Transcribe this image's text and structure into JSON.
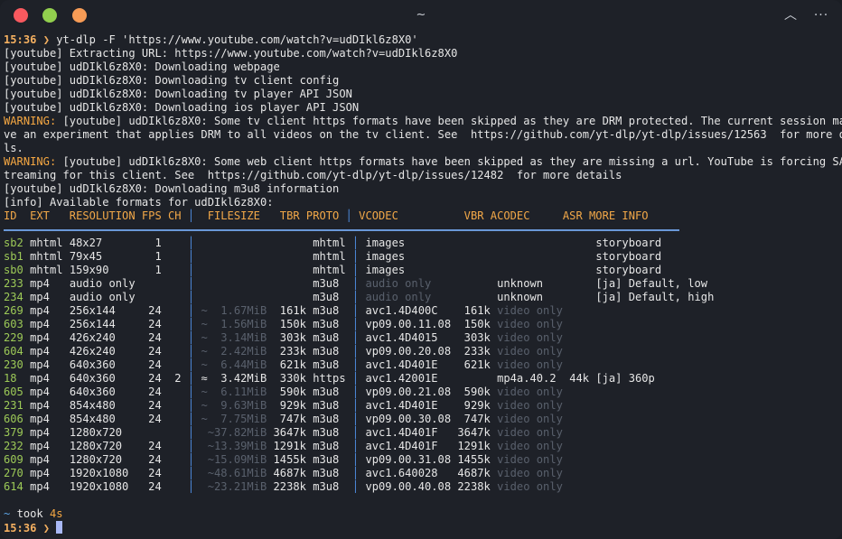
{
  "window": {
    "title": "~"
  },
  "titlebar_buttons": {
    "up": "︿",
    "more": "···"
  },
  "command": {
    "time": "15:36",
    "arrow": "❯",
    "text": "yt-dlp -F 'https://www.youtube.com/watch?v=udDIkl6z8X0'"
  },
  "log": [
    "[youtube] Extracting URL: https://www.youtube.com/watch?v=udDIkl6z8X0",
    "[youtube] udDIkl6z8X0: Downloading webpage",
    "[youtube] udDIkl6z8X0: Downloading tv client config",
    "[youtube] udDIkl6z8X0: Downloading tv player API JSON",
    "[youtube] udDIkl6z8X0: Downloading ios player API JSON"
  ],
  "warning1": {
    "label": "WARNING:",
    "lines": [
      " [youtube] udDIkl6z8X0: Some tv client https formats have been skipped as they are DRM protected. The current session may ha",
      "ve an experiment that applies DRM to all videos on the tv client. See  https://github.com/yt-dlp/yt-dlp/issues/12563  for more detai",
      "ls."
    ]
  },
  "warning2": {
    "label": "WARNING:",
    "lines": [
      " [youtube] udDIkl6z8X0: Some web client https formats have been skipped as they are missing a url. YouTube is forcing SABR s",
      "treaming for this client. See  https://github.com/yt-dlp/yt-dlp/issues/12482  for more details"
    ]
  },
  "log2": [
    "[youtube] udDIkl6z8X0: Downloading m3u8 information",
    "[info] Available formats for udDIkl6z8X0:"
  ],
  "header": {
    "a": "ID  EXT   RESOLUTION FPS CH ",
    "bar1": "│",
    "b": "  FILESIZE   TBR PROTO ",
    "bar2": "│",
    "c": " VCODEC          VBR ACODEC     ASR MORE INFO"
  },
  "formats": [
    {
      "id": "sb2",
      "ext": "mhtml",
      "res": "48x27",
      "fps": "1",
      "ch": "",
      "fs": "",
      "tbr": "",
      "proto": "mhtml",
      "vcodec": "images",
      "vbr": "",
      "acodec": "",
      "asr": "",
      "info": "storyboard"
    },
    {
      "id": "sb1",
      "ext": "mhtml",
      "res": "79x45",
      "fps": "1",
      "ch": "",
      "fs": "",
      "tbr": "",
      "proto": "mhtml",
      "vcodec": "images",
      "vbr": "",
      "acodec": "",
      "asr": "",
      "info": "storyboard"
    },
    {
      "id": "sb0",
      "ext": "mhtml",
      "res": "159x90",
      "fps": "1",
      "ch": "",
      "fs": "",
      "tbr": "",
      "proto": "mhtml",
      "vcodec": "images",
      "vbr": "",
      "acodec": "",
      "asr": "",
      "info": "storyboard"
    },
    {
      "id": "233",
      "ext": "mp4",
      "res": "audio only",
      "fps": "",
      "ch": "",
      "fs": "",
      "tbr": "",
      "proto": "m3u8",
      "vcodec": "audio only",
      "vbr": "",
      "acodec": "unknown",
      "asr": "",
      "info": "[ja] Default, low"
    },
    {
      "id": "234",
      "ext": "mp4",
      "res": "audio only",
      "fps": "",
      "ch": "",
      "fs": "",
      "tbr": "",
      "proto": "m3u8",
      "vcodec": "audio only",
      "vbr": "",
      "acodec": "unknown",
      "asr": "",
      "info": "[ja] Default, high"
    },
    {
      "id": "269",
      "ext": "mp4",
      "res": "256x144",
      "fps": "24",
      "ch": "",
      "fs": "~  1.67MiB",
      "tbr": "161k",
      "proto": "m3u8",
      "vcodec": "avc1.4D400C",
      "vbr": "161k",
      "acodec": "video only",
      "asr": "",
      "info": ""
    },
    {
      "id": "603",
      "ext": "mp4",
      "res": "256x144",
      "fps": "24",
      "ch": "",
      "fs": "~  1.56MiB",
      "tbr": "150k",
      "proto": "m3u8",
      "vcodec": "vp09.00.11.08",
      "vbr": "150k",
      "acodec": "video only",
      "asr": "",
      "info": ""
    },
    {
      "id": "229",
      "ext": "mp4",
      "res": "426x240",
      "fps": "24",
      "ch": "",
      "fs": "~  3.14MiB",
      "tbr": "303k",
      "proto": "m3u8",
      "vcodec": "avc1.4D4015",
      "vbr": "303k",
      "acodec": "video only",
      "asr": "",
      "info": ""
    },
    {
      "id": "604",
      "ext": "mp4",
      "res": "426x240",
      "fps": "24",
      "ch": "",
      "fs": "~  2.42MiB",
      "tbr": "233k",
      "proto": "m3u8",
      "vcodec": "vp09.00.20.08",
      "vbr": "233k",
      "acodec": "video only",
      "asr": "",
      "info": ""
    },
    {
      "id": "230",
      "ext": "mp4",
      "res": "640x360",
      "fps": "24",
      "ch": "",
      "fs": "~  6.44MiB",
      "tbr": "621k",
      "proto": "m3u8",
      "vcodec": "avc1.4D401E",
      "vbr": "621k",
      "acodec": "video only",
      "asr": "",
      "info": ""
    },
    {
      "id": "18",
      "ext": "mp4",
      "res": "640x360",
      "fps": "24",
      "ch": "2",
      "fs": "≈  3.42MiB",
      "tbr": "330k",
      "proto": "https",
      "vcodec": "avc1.42001E",
      "vbr": "",
      "acodec": "mp4a.40.2",
      "asr": "44k",
      "info": "[ja] 360p"
    },
    {
      "id": "605",
      "ext": "mp4",
      "res": "640x360",
      "fps": "24",
      "ch": "",
      "fs": "~  6.11MiB",
      "tbr": "590k",
      "proto": "m3u8",
      "vcodec": "vp09.00.21.08",
      "vbr": "590k",
      "acodec": "video only",
      "asr": "",
      "info": ""
    },
    {
      "id": "231",
      "ext": "mp4",
      "res": "854x480",
      "fps": "24",
      "ch": "",
      "fs": "~  9.63MiB",
      "tbr": "929k",
      "proto": "m3u8",
      "vcodec": "avc1.4D401E",
      "vbr": "929k",
      "acodec": "video only",
      "asr": "",
      "info": ""
    },
    {
      "id": "606",
      "ext": "mp4",
      "res": "854x480",
      "fps": "24",
      "ch": "",
      "fs": "~  7.75MiB",
      "tbr": "747k",
      "proto": "m3u8",
      "vcodec": "vp09.00.30.08",
      "vbr": "747k",
      "acodec": "video only",
      "asr": "",
      "info": ""
    },
    {
      "id": "379",
      "ext": "mp4",
      "res": "1280x720",
      "fps": "",
      "ch": "",
      "fs": "~37.82MiB",
      "tbr": "3647k",
      "proto": "m3u8",
      "vcodec": "avc1.4D401F",
      "vbr": "3647k",
      "acodec": "video only",
      "asr": "",
      "info": ""
    },
    {
      "id": "232",
      "ext": "mp4",
      "res": "1280x720",
      "fps": "24",
      "ch": "",
      "fs": "~13.39MiB",
      "tbr": "1291k",
      "proto": "m3u8",
      "vcodec": "avc1.4D401F",
      "vbr": "1291k",
      "acodec": "video only",
      "asr": "",
      "info": ""
    },
    {
      "id": "609",
      "ext": "mp4",
      "res": "1280x720",
      "fps": "24",
      "ch": "",
      "fs": "~15.09MiB",
      "tbr": "1455k",
      "proto": "m3u8",
      "vcodec": "vp09.00.31.08",
      "vbr": "1455k",
      "acodec": "video only",
      "asr": "",
      "info": ""
    },
    {
      "id": "270",
      "ext": "mp4",
      "res": "1920x1080",
      "fps": "24",
      "ch": "",
      "fs": "~48.61MiB",
      "tbr": "4687k",
      "proto": "m3u8",
      "vcodec": "avc1.640028",
      "vbr": "4687k",
      "acodec": "video only",
      "asr": "",
      "info": ""
    },
    {
      "id": "614",
      "ext": "mp4",
      "res": "1920x1080",
      "fps": "24",
      "ch": "",
      "fs": "~23.21MiB",
      "tbr": "2238k",
      "proto": "m3u8",
      "vcodec": "vp09.00.40.08",
      "vbr": "2238k",
      "acodec": "video only",
      "asr": "",
      "info": ""
    }
  ],
  "footer": {
    "took_prefix": "~",
    "took_label": "took",
    "took_value": "4s",
    "time": "15:36",
    "arrow": "❯"
  }
}
